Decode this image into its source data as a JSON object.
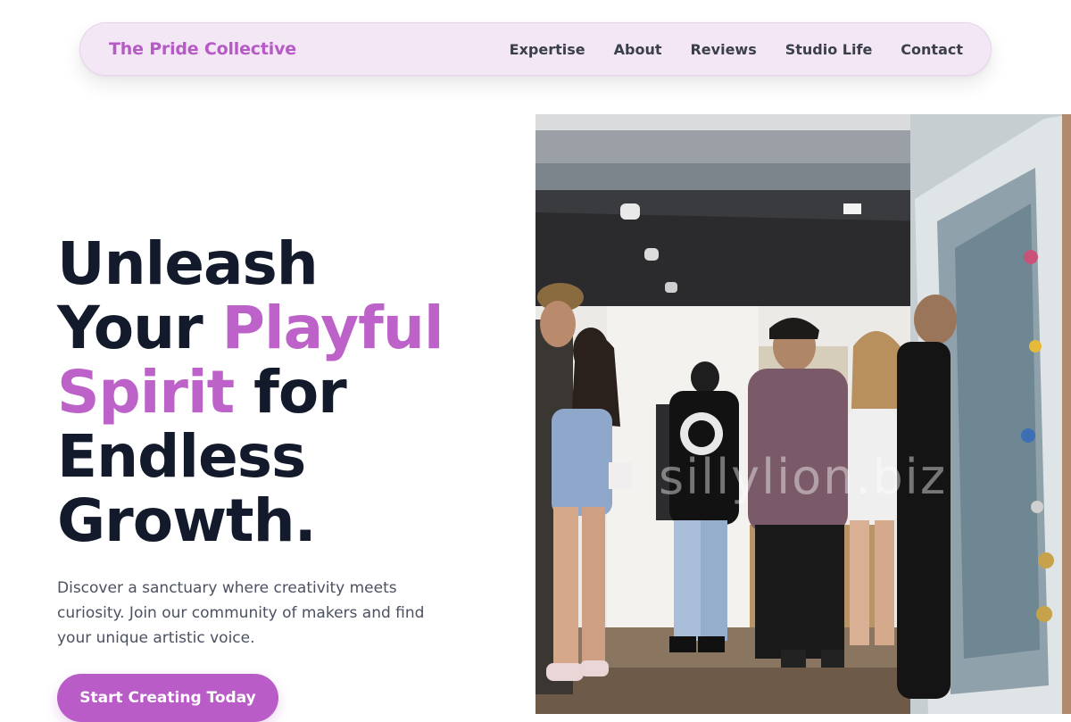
{
  "nav": {
    "brand": "The Pride Collective",
    "links": [
      "Expertise",
      "About",
      "Reviews",
      "Studio Life",
      "Contact"
    ]
  },
  "hero": {
    "headline": {
      "line1": "Unleash",
      "line2_a": "Your ",
      "line2_b": "Playful",
      "line3_a": "Spirit",
      "line3_b": " for",
      "line4": "Endless",
      "line5": "Growth."
    },
    "subtext": "Discover a sanctuary where creativity meets curiosity. Join our community of makers and find your unique artistic voice.",
    "cta_label": "Start Creating Today",
    "image": {
      "watermark": "sillylion.biz"
    }
  },
  "colors": {
    "brand_accent": "#bd62c9",
    "nav_background": "#f3e7f5",
    "headline": "#131a2c",
    "body_text": "#4b5160"
  }
}
